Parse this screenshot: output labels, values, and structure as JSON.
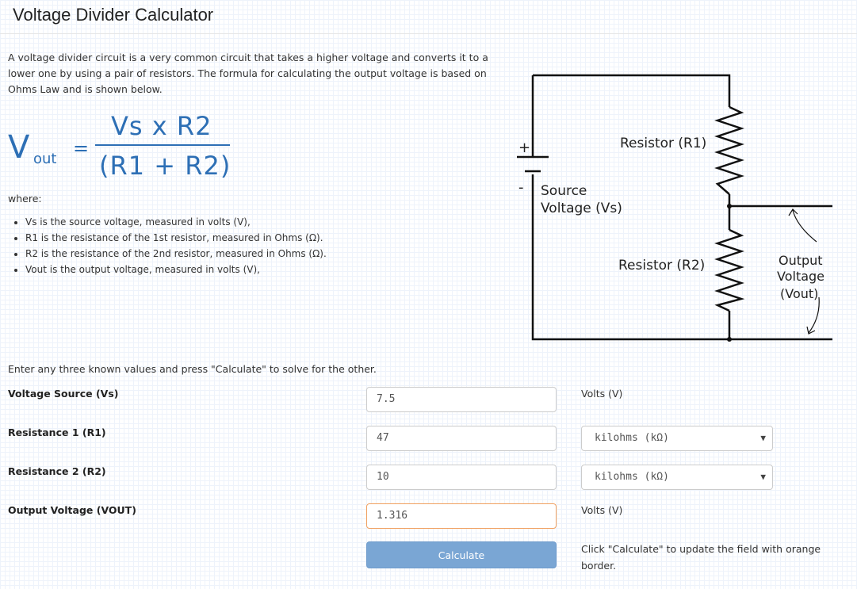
{
  "page": {
    "title": "Voltage Divider Calculator"
  },
  "intro": "A voltage divider circuit is a very common circuit that takes a higher voltage and converts it to a lower one by using a pair of resistors. The formula for calculating the output voltage is based on Ohms Law and is shown below.",
  "formula": {
    "lhs_v": "V",
    "lhs_sub": "out",
    "equals": "=",
    "numerator": "Vs x R2",
    "denominator": "(R1 + R2)"
  },
  "where_label": "where:",
  "definitions": [
    "Vs is the source voltage, measured in volts (V),",
    "R1 is the resistance of the 1st resistor, measured in Ohms (Ω).",
    "R2 is the resistance of the 2nd resistor, measured in Ohms (Ω).",
    "Vout is the output voltage, measured in volts (V),"
  ],
  "diagram": {
    "resistor1_label": "Resistor (R1)",
    "resistor2_label": "Resistor (R2)",
    "source_label_line1": "Source",
    "source_label_line2": "Voltage (Vs)",
    "plus": "+",
    "minus": "-",
    "output_line1": "Output",
    "output_line2": "Voltage",
    "output_line3": "(Vout)"
  },
  "instruction": "Enter any three known values and press \"Calculate\" to solve for the other.",
  "rows": [
    {
      "label": "Voltage Source (Vs)",
      "value": "7.5",
      "unit": "Volts (V)"
    },
    {
      "label": "Resistance 1 (R1)",
      "value": "47",
      "unit": "kilohms (kΩ)"
    },
    {
      "label": "Resistance 2 (R2)",
      "value": "10",
      "unit": "kilohms (kΩ)"
    },
    {
      "label": "Output Voltage (VOUT)",
      "value": "1.316",
      "unit": "Volts (V)"
    }
  ],
  "calculate_label": "Calculate",
  "note": "Click \"Calculate\" to update the field with orange border.",
  "colors": {
    "formula": "#2d6fb5",
    "button": "#7aa6d4",
    "highlight_border": "#f0a060"
  }
}
